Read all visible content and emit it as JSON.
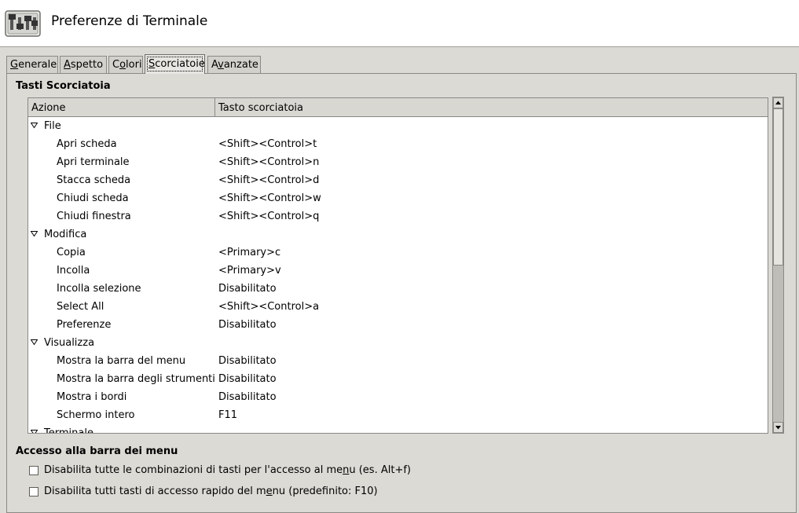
{
  "window": {
    "title": "Preferenze di Terminale",
    "icon": "preferences-toggles-icon"
  },
  "tabs": [
    {
      "pre": "",
      "mn": "G",
      "post": "enerale"
    },
    {
      "pre": "",
      "mn": "A",
      "post": "spetto"
    },
    {
      "pre": "C",
      "mn": "o",
      "post": "lori"
    },
    {
      "pre": "",
      "mn": "S",
      "post": "corciatoie"
    },
    {
      "pre": "A",
      "mn": "v",
      "post": "anzate"
    }
  ],
  "active_tab": 3,
  "shortcuts": {
    "section_title": "Tasti Scorciatoia",
    "columns": {
      "action": "Azione",
      "key": "Tasto scorciatoia"
    },
    "groups": [
      {
        "name": "File",
        "items": [
          {
            "action": "Apri scheda",
            "key": "<Shift><Control>t"
          },
          {
            "action": "Apri terminale",
            "key": "<Shift><Control>n"
          },
          {
            "action": "Stacca scheda",
            "key": "<Shift><Control>d"
          },
          {
            "action": "Chiudi scheda",
            "key": "<Shift><Control>w"
          },
          {
            "action": "Chiudi finestra",
            "key": "<Shift><Control>q"
          }
        ]
      },
      {
        "name": "Modifica",
        "items": [
          {
            "action": "Copia",
            "key": "<Primary>c"
          },
          {
            "action": "Incolla",
            "key": "<Primary>v"
          },
          {
            "action": "Incolla selezione",
            "key": "Disabilitato"
          },
          {
            "action": "Select All",
            "key": "<Shift><Control>a"
          },
          {
            "action": "Preferenze",
            "key": "Disabilitato"
          }
        ]
      },
      {
        "name": "Visualizza",
        "items": [
          {
            "action": "Mostra la barra del menu",
            "key": "Disabilitato"
          },
          {
            "action": "Mostra la barra degli strumenti",
            "key": "Disabilitato"
          },
          {
            "action": "Mostra i bordi",
            "key": "Disabilitato"
          },
          {
            "action": "Schermo intero",
            "key": "F11"
          }
        ]
      },
      {
        "name": "Terminale",
        "items": []
      }
    ]
  },
  "menubar_access": {
    "section_title": "Accesso alla barra dei menu",
    "options": [
      {
        "pre": "Disabilita tutte le combinazioni di tasti per l'accesso al me",
        "mn": "n",
        "post": "u (es. Alt+f)",
        "checked": false
      },
      {
        "pre": "Disabilita tutti tasti di accesso rapido del m",
        "mn": "e",
        "post": "nu (predefinito: F10)",
        "checked": false
      }
    ]
  }
}
